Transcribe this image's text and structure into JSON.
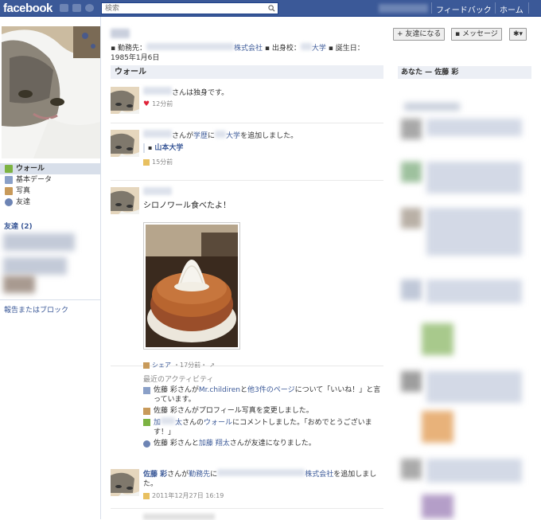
{
  "topbar": {
    "logo": "facebook",
    "search_placeholder": "検索",
    "links": [
      "フィードバック",
      "ホーム"
    ]
  },
  "left": {
    "nav": [
      {
        "label": "ウォール",
        "icon": "wall-icon",
        "active": true
      },
      {
        "label": "基本データ",
        "icon": "info-icon",
        "active": false
      },
      {
        "label": "写真",
        "icon": "photos-icon",
        "active": false
      },
      {
        "label": "友達",
        "icon": "friends-icon",
        "active": false
      }
    ],
    "friends_heading": "友達 (2)",
    "report_link": "報告またはブロック"
  },
  "profile": {
    "work_label": "勤務先：",
    "work_company_suffix": "株式会社",
    "school_label": "出身校：",
    "school_suffix": "大学",
    "birthday_label": "誕生日：",
    "birthday": "1985年1月6日"
  },
  "wall": {
    "heading": "ウォール",
    "stories": [
      {
        "text": "さんは独身です。",
        "time": "12分前"
      },
      {
        "text_pre": "さんが",
        "link1": "学歴",
        "mid": "に",
        "link2": "大学",
        "post": "を追加しました。",
        "school": "山本大学",
        "time": "15分前"
      },
      {
        "text": "シロノワール食べたよ！",
        "share": "シェア",
        "time": "・17分前・"
      }
    ],
    "activity": {
      "title": "最近のアクティビティ",
      "rows": [
        {
          "name": "佐藤 彩",
          "pre": "さんが",
          "link1": "Mr.childiren",
          "mid": "と",
          "link2": "他3件のページ",
          "post": "について「いいね！」と言っています。"
        },
        {
          "name": "佐藤 彩",
          "post": "さんがプロフィール写真を変更しました。"
        },
        {
          "pre_name": "加",
          "mid_name": "太",
          "pre": "さんの",
          "link1": "ウォール",
          "post": "にコメントしました。「おめでとうございます！」"
        },
        {
          "name": "佐藤 彩",
          "pre": "さんと",
          "link1": "加藤 翔太",
          "post": "さんが友達になりました。"
        }
      ]
    },
    "last_story": {
      "name": "佐藤 彩",
      "pre": "さんが",
      "link1": "勤務先",
      "mid": "に",
      "suffix": "株式会社",
      "post": "を追加しました。",
      "time": "2011年12月27日 16:19"
    }
  },
  "right": {
    "buttons": [
      "友達になる",
      "メッセージ",
      "✱▾"
    ],
    "you_heading": "あなた — 佐藤 彩"
  }
}
